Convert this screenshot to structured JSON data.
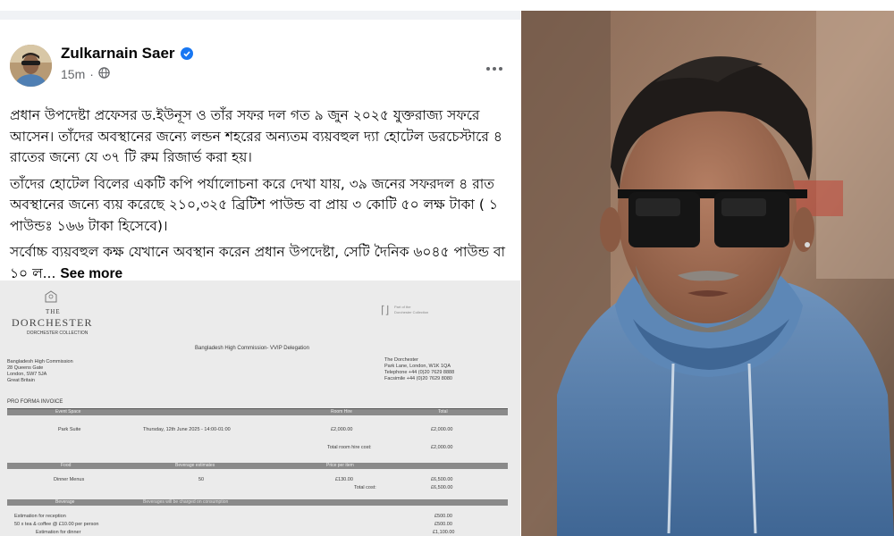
{
  "post": {
    "author": "Zulkarnain Saer",
    "time": "15m",
    "paragraphs": [
      "প্রধান উপদেষ্টা প্রফেসর ড.ইউনূস ও তাঁর সফর দল গত ৯ জুন ২০২৫ যুক্তরাজ্য সফরে আসেন। তাঁদের অবস্থানের জন্যে লন্ডন শহরের অন্যতম ব্যয়বহুল দ্যা হোটেল ডরচেস্টারে ৪ রাতের জন্যে যে ৩৭ টি রুম রিজার্ভ করা হয়।",
      "তাঁদের হোটেল বিলের একটি কপি পর্যালোচনা করে দেখা যায়, ৩৯ জনের সফরদল ৪ রাত অবস্থানের জন্যে ব্যয় করেছে ২১০,৩২৫ ব্রিটিশ পাউন্ড বা প্রায় ৩ কোটি ৫০ লক্ষ টাকা ( ১ পাউন্ডঃ ১৬৬ টাকা হিসেবে)।",
      "সর্বোচ্চ ব্যয়বহুল কক্ষ যেখানে অবস্থান করেন প্রধান উপদেষ্টা, সেটি দৈনিক ৬০৪৫ পাউন্ড বা ১০ ল..."
    ],
    "see_more": "See more",
    "icons": {
      "verified": "verified-badge-icon",
      "audience": "globe-icon",
      "options": "more-options-icon"
    },
    "accent_color": "#1877f2"
  },
  "invoice": {
    "brand_the": "THE",
    "brand": "DORCHESTER",
    "collection": "DORCHESTER COLLECTION",
    "delegation": "Bangladesh High Commission- VVIP Delegation",
    "right_logo_line1": "Part of the",
    "right_logo_line2": "Dorchester Collection",
    "bill_to": [
      "Bangladesh High Commission",
      "28 Queens Gate",
      "London, SW7 5JA",
      "Great Britain"
    ],
    "hotel": [
      "The Dorchester",
      "Park Lane, London, W1K 1QA",
      "Telephone +44 (0)20 7629 8888",
      "Facsimile +44 (0)20 7629 8080"
    ],
    "title": "PRO FORMA INVOICE",
    "sections": {
      "event_space": "Event Space",
      "room_hire": "Room Hire",
      "total_head": "Total",
      "food": "Food",
      "beverage_estimates": "Beverage estimates",
      "price_per_item": "Price per item",
      "beverage": "Beverage",
      "beverage_note": "Beverages will be charged on consumption"
    },
    "rows": {
      "park_suite": "Park Suite",
      "date": "Thursday, 12th June 2025 - 14:00-01:00",
      "room_hire_price": "£2,000.00",
      "room_hire_total": "£2,000.00",
      "total_room_hire_label": "Total room hire cost:",
      "total_room_hire_value": "£2,000.00",
      "dinner": "Dinner Menus",
      "dinner_qty": "50",
      "dinner_price": "£130.00",
      "dinner_total": "£6,500.00",
      "total_cost_label": "Total cost:",
      "total_cost_value": "£6,500.00",
      "est_reception": "Estimation for reception",
      "tea_coffee": "50 x tea & coffee @ £10.00 per person",
      "est_dinner": "Estimation for dinner",
      "bev_1": "£500.00",
      "bev_2": "£500.00",
      "bev_3": "£1,100.00"
    }
  },
  "photo": {
    "subject": "Man in sunglasses wearing a blue hoodie"
  }
}
